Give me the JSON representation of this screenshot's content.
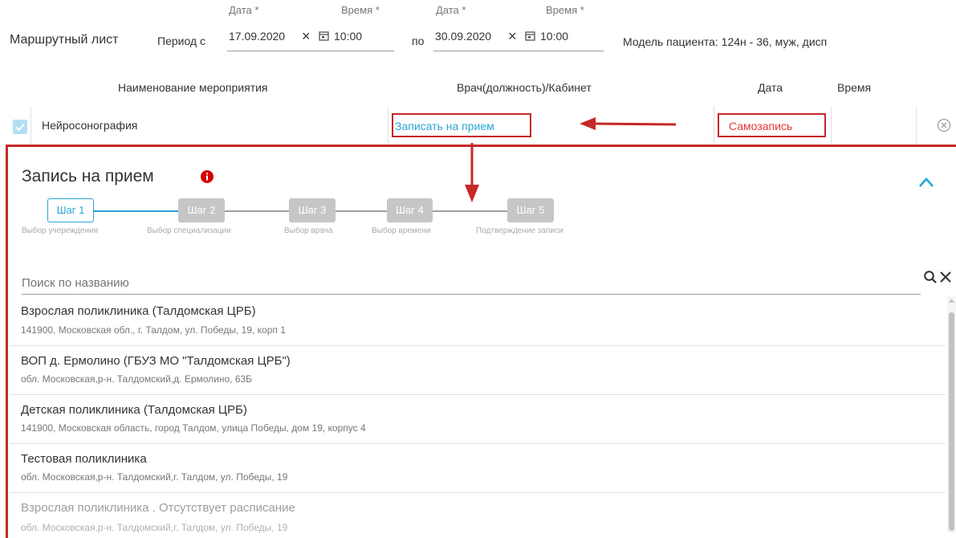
{
  "route_sheet": {
    "title": "Маршрутный лист",
    "period_from_label": "Период с",
    "date_label": "Дата *",
    "time_label": "Время *",
    "from_date": "17.09.2020",
    "from_time": "10:00",
    "to_label": "по",
    "to_date": "30.09.2020",
    "to_time": "10:00",
    "patient_model": "Модель пациента: 124н - 36, муж, дисп",
    "clear_glyph": "×"
  },
  "table": {
    "headers": {
      "name": "Наименование мероприятия",
      "doctor": "Врач(должность)/Кабинет",
      "date": "Дата",
      "time": "Время"
    },
    "row": {
      "checked": true,
      "name": "Нейросонография",
      "book_link": "Записать на прием",
      "self_booking": "Самозапись"
    }
  },
  "appointment": {
    "title": "Запись на прием",
    "steps": [
      {
        "label": "Шаг 1",
        "caption": "Выбор учереждения",
        "active": true
      },
      {
        "label": "Шаг 2",
        "caption": "Выбор специализации",
        "active": false
      },
      {
        "label": "Шаг 3",
        "caption": "Выбор врача",
        "active": false
      },
      {
        "label": "Шаг 4",
        "caption": "Выбор времени",
        "active": false
      },
      {
        "label": "Шаг 5",
        "caption": "Подтверждение записи",
        "active": false
      }
    ],
    "search": {
      "placeholder": "Поиск по названию"
    },
    "facilities": [
      {
        "name": "Взрослая поликлиника (Талдомская ЦРБ)",
        "address": "141900, Московская обл., г. Талдом, ул. Победы, 19, корп 1",
        "disabled": false
      },
      {
        "name": "ВОП д. Ермолино (ГБУЗ МО \"Талдомская ЦРБ\")",
        "address": "обл. Московская,р-н. Талдомский,д. Ермолино, 63Б",
        "disabled": false
      },
      {
        "name": "Детская поликлиника (Талдомская ЦРБ)",
        "address": "141900, Московская область, город Талдом, улица Победы, дом 19, корпус 4",
        "disabled": false
      },
      {
        "name": "Тестовая поликлиника",
        "address": "обл. Московская,р-н. Талдомский,г. Талдом, ул. Победы, 19",
        "disabled": false
      },
      {
        "name": "Взрослая поликлиника . Отсутствует расписание",
        "address": "обл. Московская,р-н. Талдомский,г. Талдом, ул. Победы, 19",
        "disabled": true
      }
    ]
  },
  "colors": {
    "accent": "#29a5d8",
    "highlight_red": "#c62828",
    "self_booking_text": "#e53935",
    "info_badge": "#d50000"
  },
  "icons": {
    "calendar": "calendar-icon",
    "clear": "close-icon",
    "remove": "remove-circle-icon",
    "info": "info-icon",
    "collapse": "chevron-up-icon",
    "search": "search-icon",
    "arrow": "arrow-icon"
  }
}
